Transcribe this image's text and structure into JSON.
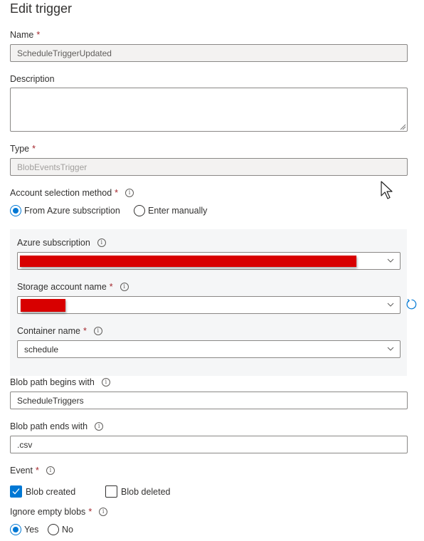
{
  "panel": {
    "title": "Edit trigger"
  },
  "fields": {
    "name": {
      "label": "Name",
      "required": "*",
      "value": "ScheduleTriggerUpdated"
    },
    "description": {
      "label": "Description",
      "value": ""
    },
    "type": {
      "label": "Type",
      "required": "*",
      "value": "BlobEventsTrigger"
    },
    "account_method": {
      "label": "Account selection method",
      "required": "*",
      "info": "i",
      "options": [
        {
          "label": "From Azure subscription",
          "selected": true
        },
        {
          "label": "Enter manually",
          "selected": false
        }
      ]
    },
    "azure_subscription": {
      "label": "Azure subscription",
      "info": "i",
      "value_redacted": true
    },
    "storage_account": {
      "label": "Storage account name",
      "required": "*",
      "info": "i",
      "value_redacted": true
    },
    "container": {
      "label": "Container name",
      "required": "*",
      "info": "i",
      "value": "schedule"
    },
    "blob_begins": {
      "label": "Blob path begins with",
      "info": "i",
      "value": "ScheduleTriggers"
    },
    "blob_ends": {
      "label": "Blob path ends with",
      "info": "i",
      "value": ".csv"
    },
    "event": {
      "label": "Event",
      "required": "*",
      "info": "i",
      "options": [
        {
          "label": "Blob created",
          "checked": true
        },
        {
          "label": "Blob deleted",
          "checked": false
        }
      ]
    },
    "ignore_empty": {
      "label": "Ignore empty blobs",
      "required": "*",
      "info": "i",
      "options": [
        {
          "label": "Yes",
          "selected": true
        },
        {
          "label": "No",
          "selected": false
        }
      ]
    }
  },
  "icons": {
    "refresh": "refresh-icon",
    "chevron": "chevron-down-icon",
    "cursor": "mouse-cursor"
  },
  "colors": {
    "accent": "#0078d4",
    "required": "#a4262c",
    "redaction": "#d80000",
    "panel_bg": "#f5f6f7"
  }
}
